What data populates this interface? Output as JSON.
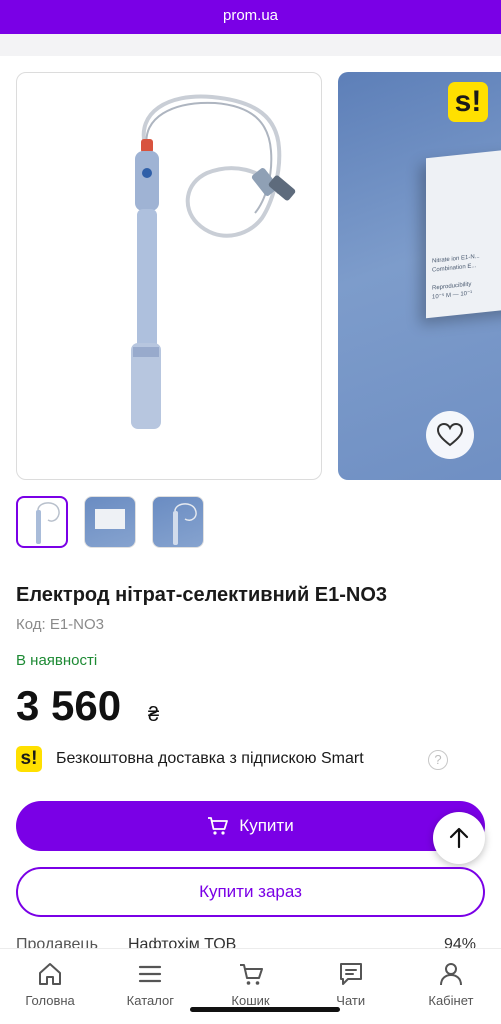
{
  "browser": {
    "url": "prom.ua"
  },
  "gallery": {
    "box_label": "Nitrate ion E1-N...\nCombination E...\n\nReproducibility\n10⁻⁵ M — 10⁻¹",
    "smart_badge": "s!",
    "favorite_icon": "heart-icon"
  },
  "product": {
    "title": "Електрод нітрат-селективний Е1-NO3",
    "code": "Код: Е1-NO3",
    "stock": "В наявності",
    "price": "3 560",
    "currency": "₴"
  },
  "delivery": {
    "badge": "s!",
    "text": "Безкоштовна доставка з підпискою Smart",
    "help": "?"
  },
  "actions": {
    "buy_label": "Купити",
    "buy_now_label": "Купити зараз"
  },
  "seller": {
    "label": "Продавець",
    "name": "Нафтохім ТОВ",
    "rating": "94%"
  },
  "tabbar": [
    {
      "label": "Головна",
      "icon": "home-icon"
    },
    {
      "label": "Каталог",
      "icon": "menu-icon"
    },
    {
      "label": "Кошик",
      "icon": "cart-icon"
    },
    {
      "label": "Чати",
      "icon": "chat-icon"
    },
    {
      "label": "Кабінет",
      "icon": "user-icon"
    }
  ],
  "colors": {
    "brand": "#7a00e6",
    "in_stock": "#1d8a34",
    "smart_yellow": "#ffe000"
  }
}
